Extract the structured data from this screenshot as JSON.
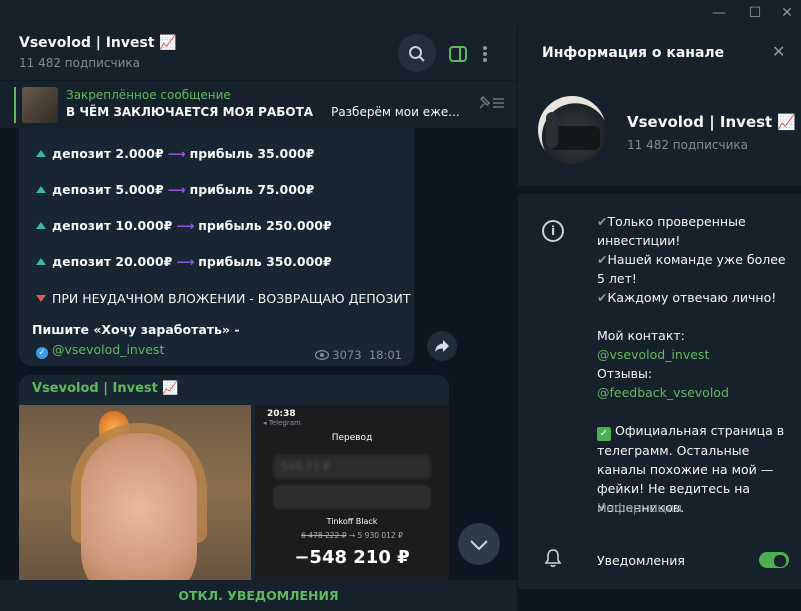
{
  "window": {
    "minimize": "—",
    "maximize": "☐",
    "close": "✕"
  },
  "header": {
    "title": "Vsevolod | Invest 📈",
    "subscribers": "11 482 подписчика"
  },
  "pinned": {
    "label": "Закреплённое сообщение",
    "text_bold": "В ЧЁМ ЗАКЛЮЧАЕТСЯ МОЯ РАБОТА",
    "text_rest": "Разберём мои еже..."
  },
  "message1": {
    "rows": [
      {
        "deposit": "депозит 2.000₽",
        "profit": "прибыль 35.000₽"
      },
      {
        "deposit": "депозит 5.000₽",
        "profit": "прибыль 75.000₽"
      },
      {
        "deposit": "депозит 10.000₽",
        "profit": "прибыль 250.000₽"
      },
      {
        "deposit": "депозит 20.000₽",
        "profit": "прибыль 350.000₽"
      }
    ],
    "warning": "ПРИ НЕУДАЧНОМ ВЛОЖЕНИИ - ВОЗВРАЩАЮ ДЕПОЗИТ",
    "cta": "Пишите «Хочу заработать» -",
    "handle": "@vsevolod_invest",
    "views": "3073",
    "time": "18:01"
  },
  "message2": {
    "author": "Vsevolod | Invest 📈",
    "phone": {
      "time": "20:38",
      "app": "◂ Telegram",
      "heading": "Перевод",
      "amount_blur": "550,73 ₽",
      "bank": "Tinkoff Black",
      "balance_old": "6 478 222 ₽",
      "balance_new": "5 930 012 ₽",
      "sum": "−548 210 ₽"
    }
  },
  "bottom_bar": {
    "label": "ОТКЛ. УВЕДОМЛЕНИЯ"
  },
  "panel": {
    "title": "Информация о канале",
    "channel_name": "Vsevolod | Invest 📈",
    "channel_sub": "11 482 подписчика",
    "desc_lines": [
      "Только проверенные инвестиции!",
      "Нашей команде уже более 5 лет!",
      "Каждому отвечаю лично!"
    ],
    "contact_label": "Мой контакт:",
    "contact_handle": "@vsevolod_invest",
    "reviews_label": "Отзывы:",
    "reviews_handle": "@feedback_vsevolod",
    "official": "Официальная страница в телеграмм. Остальные каналы похожие на мой — фейки! Не ведитесь на мошенников.",
    "info_label": "Информация",
    "notifications_label": "Уведомления",
    "notifications_on": true
  },
  "colors": {
    "accent": "#5fb95f",
    "bg": "#17212b",
    "chat_bg": "#0e1621",
    "bubble": "#182533"
  }
}
